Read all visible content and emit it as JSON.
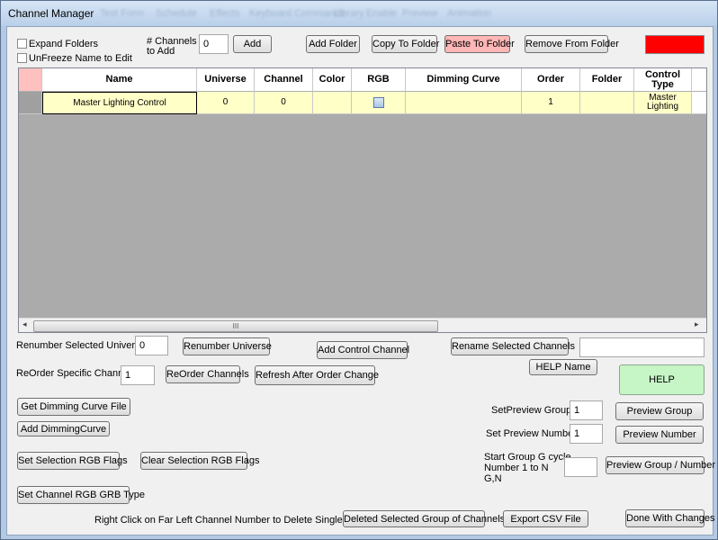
{
  "window": {
    "title": "Channel Manager",
    "blurred_menu": [
      "Test Form",
      "Schedule",
      "Effects",
      "Keyboard Commands",
      "Library",
      "Enable",
      "Preview",
      "Animation"
    ]
  },
  "toolbar": {
    "expand_folders": "Expand Folders",
    "unfreeze": "UnFreeze Name to Edit",
    "channels_to_add_label_1": "# Channels",
    "channels_to_add_label_2": "to Add",
    "channels_to_add_value": "0",
    "add": "Add",
    "add_folder": "Add Folder",
    "copy_to_folder": "Copy To Folder",
    "paste_to_folder": "Paste To Folder",
    "remove_from_folder": "Remove From Folder",
    "color_swatch": "#ff0000"
  },
  "grid": {
    "columns": [
      "Name",
      "Universe",
      "Channel",
      "Color",
      "RGB",
      "Dimming Curve",
      "Order",
      "Folder",
      "Control Type"
    ],
    "rows": [
      {
        "name": "Master Lighting Control",
        "universe": "0",
        "channel": "0",
        "color": "",
        "rgb": "",
        "dimming_curve": "",
        "order": "1",
        "folder": "",
        "control_type": "Master Lighting"
      }
    ],
    "scroll_grip": "III"
  },
  "controls": {
    "renumber_universe_label": "Renumber Selected Universe",
    "renumber_universe_value": "0",
    "renumber_universe_btn": "Renumber Universe",
    "add_control_channel": "Add Control Channel",
    "rename_selected_channels": "Rename Selected Channels",
    "rename_value": "",
    "help_name": "HELP Name",
    "help": "HELP",
    "reorder_label": "ReOrder Specific Channels",
    "reorder_value": "1",
    "reorder_btn": "ReOrder Channels",
    "refresh_after_order": "Refresh After Order Change",
    "get_dimming_curve_file": "Get Dimming Curve File",
    "add_dimming_curve": "Add DimmingCurve",
    "set_selection_rgb": "Set Selection RGB Flags",
    "clear_selection_rgb": "Clear Selection RGB Flags",
    "set_channel_rgb_grb": "Set Channel RGB GRB Type",
    "set_preview_group_label": "SetPreview Group",
    "set_preview_group_value": "1",
    "preview_group": "Preview Group",
    "set_preview_number_label": "Set Preview Number",
    "set_preview_number_value": "1",
    "preview_number": "Preview Number",
    "start_group_label_1": "Start Group G cycle",
    "start_group_label_2": "Number 1 to N",
    "start_group_label_3": "G,N",
    "start_group_value": "",
    "preview_group_number": "Preview Group / Number",
    "right_click_note": "Right Click on Far Left Channel Number to Delete Single Channel",
    "delete_selected_group": "Deleted Selected Group of Channels",
    "export_csv": "Export CSV File",
    "done_with_changes": "Done With Changes"
  }
}
